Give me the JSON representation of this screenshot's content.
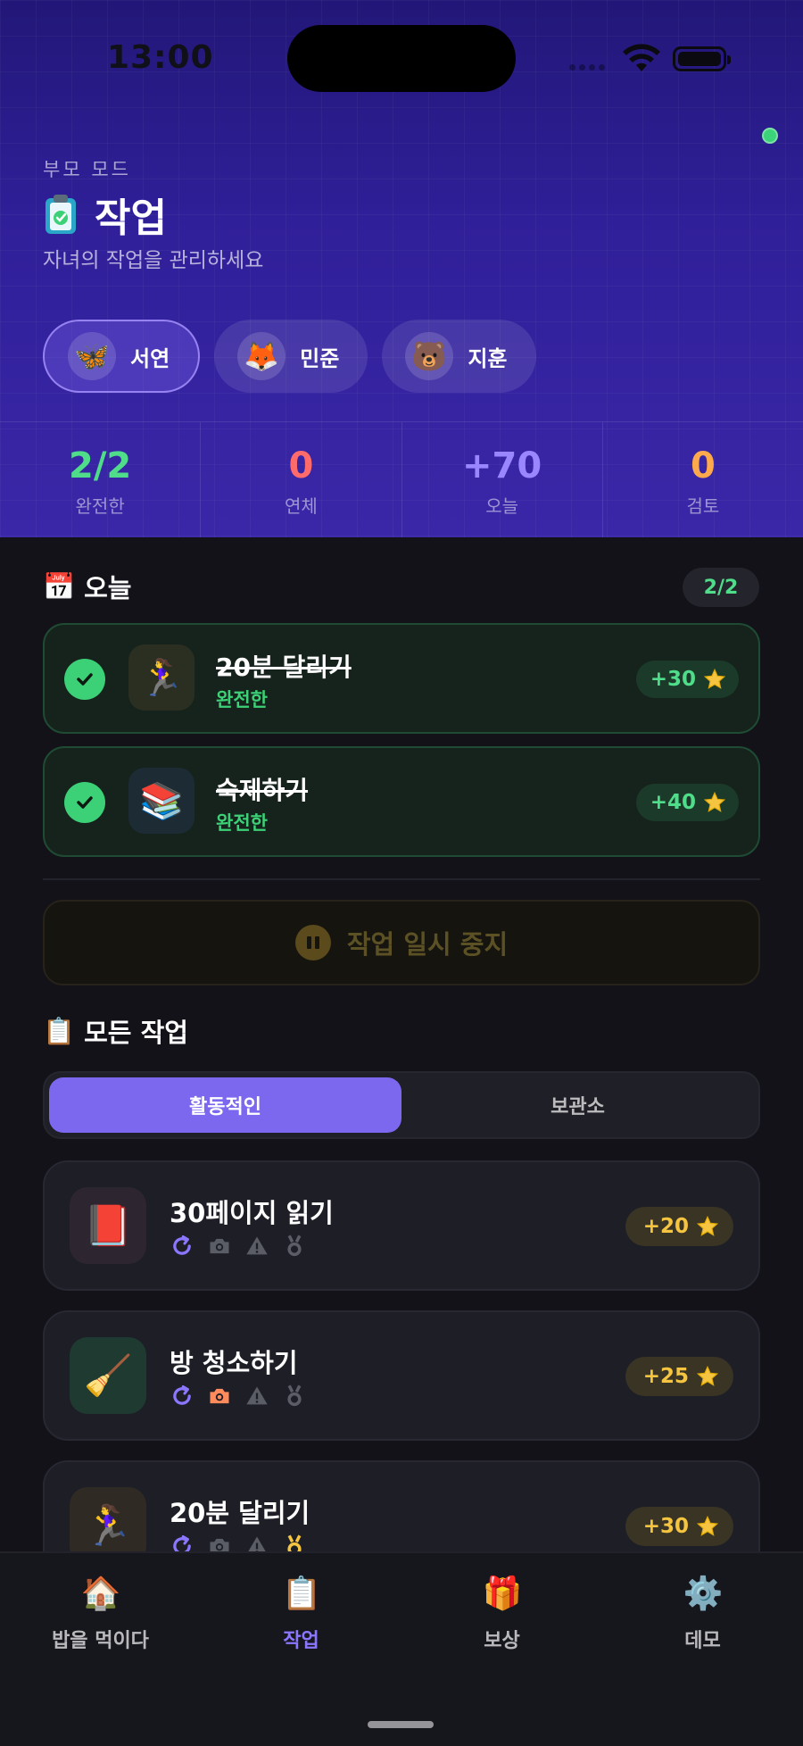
{
  "status_bar": {
    "time": "13:00"
  },
  "header": {
    "mode_label": "부모 모드",
    "title": "작업",
    "title_icon": "clipboard-check-icon",
    "subtitle": "자녀의 작업을 관리하세요",
    "kids": [
      {
        "name": "서연",
        "avatar": "🦋",
        "selected": true
      },
      {
        "name": "민준",
        "avatar": "🦊",
        "selected": false
      },
      {
        "name": "지훈",
        "avatar": "🐻",
        "selected": false
      }
    ],
    "stats": [
      {
        "value": "2/2",
        "label": "완전한",
        "color": "#4fdd8a"
      },
      {
        "value": "0",
        "label": "연체",
        "color": "#ff6b6b"
      },
      {
        "value": "+70",
        "label": "오늘",
        "color": "#9a86ff"
      },
      {
        "value": "0",
        "label": "검토",
        "color": "#ffa94d"
      }
    ]
  },
  "today": {
    "title": "오늘",
    "icon": "📅",
    "count": "2/2",
    "tasks": [
      {
        "name": "20분 달리기",
        "status": "완전한",
        "points": "+30",
        "icon": "🏃‍♀️"
      },
      {
        "name": "숙제하기",
        "status": "완전한",
        "points": "+40",
        "icon": "📚"
      }
    ]
  },
  "pause_button": {
    "label": "작업 일시 중지"
  },
  "all_tasks": {
    "title": "모든 작업",
    "icon": "📋",
    "tabs": [
      {
        "label": "활동적인",
        "active": true
      },
      {
        "label": "보관소",
        "active": false
      }
    ],
    "tasks": [
      {
        "name": "30페이지 읽기",
        "points": "+20",
        "icon": "📕",
        "photo_required": false,
        "reward_highlight": false
      },
      {
        "name": "방 청소하기",
        "points": "+25",
        "icon": "🧹",
        "photo_required": true,
        "reward_highlight": false
      },
      {
        "name": "20분 달리기",
        "points": "+30",
        "icon": "🏃‍♀️",
        "photo_required": false,
        "reward_highlight": true
      }
    ]
  },
  "tabbar": {
    "tabs": [
      {
        "label": "밥을 먹이다",
        "icon": "🏠",
        "active": false
      },
      {
        "label": "작업",
        "icon": "📋",
        "active": true
      },
      {
        "label": "보상",
        "icon": "🎁",
        "active": false
      },
      {
        "label": "데모",
        "icon": "⚙️",
        "active": false
      }
    ]
  },
  "colors": {
    "accent": "#7c68ee",
    "success": "#3cd177",
    "points_gold": "#f5c542",
    "header_gradient_top": "#221778",
    "header_gradient_bottom": "#3a27a8"
  }
}
